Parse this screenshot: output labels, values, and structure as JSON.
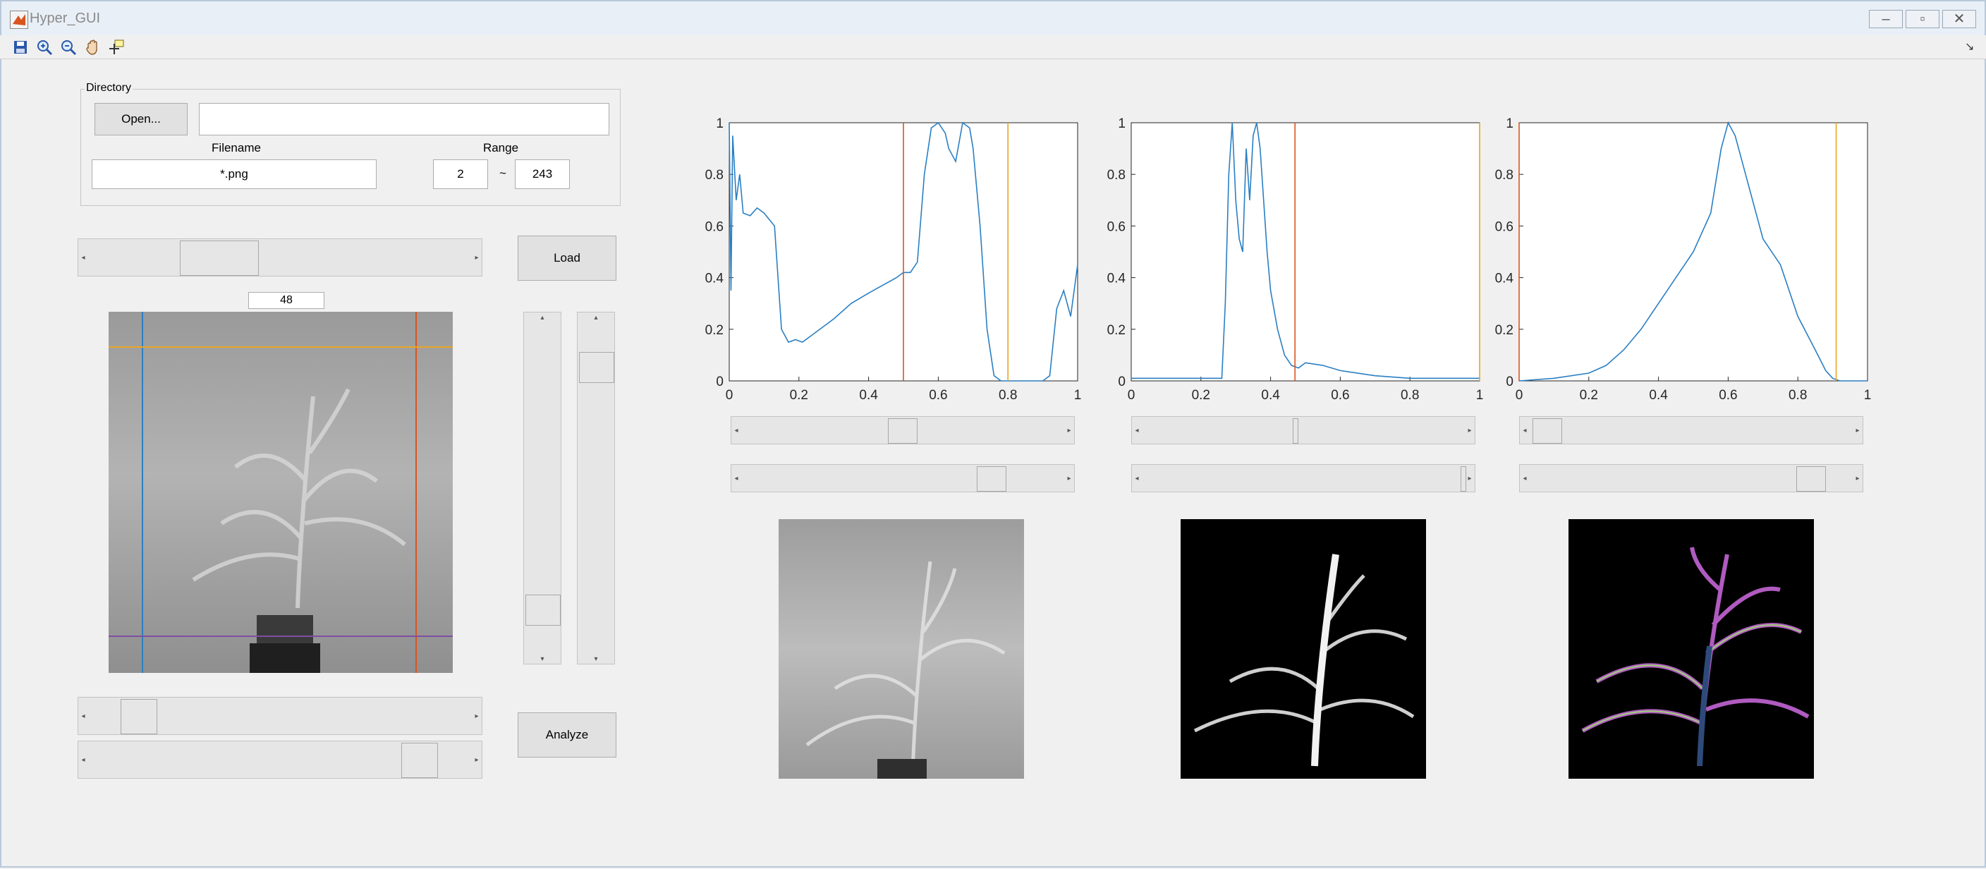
{
  "window": {
    "title": "Hyper_GUI",
    "minimize": "–",
    "maximize": "▫",
    "close": "✕"
  },
  "toolbar": {
    "tools": [
      "save-icon",
      "zoom-in-icon",
      "zoom-out-icon",
      "pan-icon",
      "data-cursor-icon"
    ],
    "dock": "↘"
  },
  "directory": {
    "legend": "Directory",
    "open_label": "Open...",
    "path_value": "",
    "filename_label": "Filename",
    "filename_value": "*.png",
    "range_label": "Range",
    "range_start": "2",
    "range_sep": "~",
    "range_end": "243"
  },
  "controls": {
    "load_label": "Load",
    "analyze_label": "Analyze",
    "band_value": "48"
  },
  "sliders": {
    "band_slider": 0.22,
    "vslider_left": 0.1,
    "vslider_right": 0.88,
    "row_slider_1": 0.12,
    "row_slider_2": 0.88,
    "plot1_low": 0.5,
    "plot1_high": 0.8,
    "plot2_low": 0.47,
    "plot2_high": 1.0,
    "plot3_low": 0.04,
    "plot3_high": 0.91
  },
  "colors": {
    "line": "#2a7fc3",
    "red": "#d9541f",
    "orange": "#e8a621",
    "blue": "#2a7fc3",
    "purple": "#7e4fa0"
  },
  "chart_data": [
    {
      "type": "line",
      "title": "",
      "xlim": [
        0,
        1
      ],
      "ylim": [
        0,
        1
      ],
      "xticks": [
        "0",
        "0.2",
        "0.4",
        "0.6",
        "0.8",
        "1"
      ],
      "yticks": [
        "0",
        "0.2",
        "0.4",
        "0.6",
        "0.8",
        "1"
      ],
      "vlines": [
        {
          "x": 0.5,
          "color": "red"
        },
        {
          "x": 0.8,
          "color": "orange"
        }
      ],
      "x": [
        0,
        0.005,
        0.01,
        0.02,
        0.03,
        0.04,
        0.06,
        0.08,
        0.1,
        0.13,
        0.15,
        0.17,
        0.19,
        0.21,
        0.25,
        0.3,
        0.35,
        0.4,
        0.44,
        0.48,
        0.5,
        0.52,
        0.54,
        0.56,
        0.58,
        0.6,
        0.62,
        0.63,
        0.65,
        0.67,
        0.69,
        0.7,
        0.72,
        0.74,
        0.76,
        0.78,
        0.8,
        0.84,
        0.9,
        0.92,
        0.94,
        0.96,
        0.98,
        1.0
      ],
      "y": [
        1.0,
        0.35,
        0.95,
        0.7,
        0.8,
        0.65,
        0.64,
        0.67,
        0.65,
        0.6,
        0.2,
        0.15,
        0.16,
        0.15,
        0.19,
        0.24,
        0.3,
        0.34,
        0.37,
        0.4,
        0.42,
        0.42,
        0.46,
        0.8,
        0.98,
        1.0,
        0.96,
        0.9,
        0.85,
        1.0,
        0.98,
        0.9,
        0.6,
        0.2,
        0.02,
        0.0,
        0.0,
        0.0,
        0.0,
        0.02,
        0.28,
        0.35,
        0.25,
        0.45
      ]
    },
    {
      "type": "line",
      "title": "",
      "xlim": [
        0,
        1
      ],
      "ylim": [
        0,
        1
      ],
      "xticks": [
        "0",
        "0.2",
        "0.4",
        "0.6",
        "0.8",
        "1"
      ],
      "yticks": [
        "0",
        "0.2",
        "0.4",
        "0.6",
        "0.8",
        "1"
      ],
      "vlines": [
        {
          "x": 0.47,
          "color": "red"
        },
        {
          "x": 1.0,
          "color": "orange"
        }
      ],
      "x": [
        0,
        0.1,
        0.2,
        0.26,
        0.27,
        0.28,
        0.29,
        0.3,
        0.31,
        0.32,
        0.33,
        0.34,
        0.35,
        0.36,
        0.37,
        0.38,
        0.39,
        0.4,
        0.42,
        0.44,
        0.46,
        0.48,
        0.5,
        0.55,
        0.6,
        0.7,
        0.8,
        0.9,
        1.0
      ],
      "y": [
        0.01,
        0.01,
        0.01,
        0.01,
        0.3,
        0.8,
        1.0,
        0.7,
        0.55,
        0.5,
        0.9,
        0.7,
        0.95,
        1.0,
        0.9,
        0.7,
        0.5,
        0.35,
        0.2,
        0.1,
        0.06,
        0.05,
        0.07,
        0.06,
        0.04,
        0.02,
        0.01,
        0.01,
        0.01
      ]
    },
    {
      "type": "line",
      "title": "",
      "xlim": [
        0,
        1
      ],
      "ylim": [
        0,
        1
      ],
      "xticks": [
        "0",
        "0.2",
        "0.4",
        "0.6",
        "0.8",
        "1"
      ],
      "yticks": [
        "0",
        "0.2",
        "0.4",
        "0.6",
        "0.8",
        "1"
      ],
      "vlines": [
        {
          "x": 0.0,
          "color": "red"
        },
        {
          "x": 0.91,
          "color": "orange"
        }
      ],
      "x": [
        0,
        0.1,
        0.2,
        0.25,
        0.3,
        0.35,
        0.4,
        0.45,
        0.5,
        0.55,
        0.58,
        0.6,
        0.62,
        0.65,
        0.7,
        0.75,
        0.8,
        0.85,
        0.88,
        0.9,
        0.92,
        1.0
      ],
      "y": [
        0,
        0.01,
        0.03,
        0.06,
        0.12,
        0.2,
        0.3,
        0.4,
        0.5,
        0.65,
        0.9,
        1.0,
        0.95,
        0.8,
        0.55,
        0.45,
        0.25,
        0.12,
        0.04,
        0.01,
        0,
        0
      ]
    }
  ]
}
